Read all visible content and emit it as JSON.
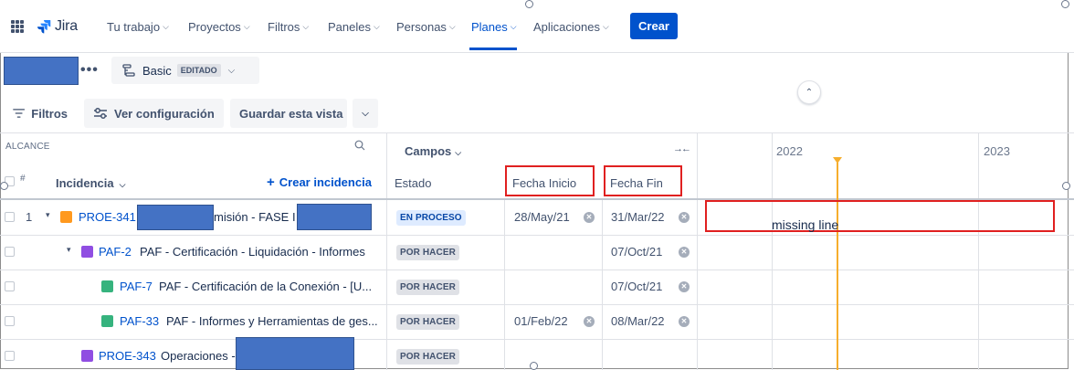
{
  "app": {
    "logo_text": "Jira",
    "icons": {
      "apps": "apps-grid-icon",
      "logo": "jira-logo-icon"
    }
  },
  "nav": {
    "items": [
      {
        "label": "Tu trabajo",
        "active": false
      },
      {
        "label": "Proyectos",
        "active": false
      },
      {
        "label": "Filtros",
        "active": false
      },
      {
        "label": "Paneles",
        "active": false
      },
      {
        "label": "Personas",
        "active": false
      },
      {
        "label": "Planes",
        "active": true
      },
      {
        "label": "Aplicaciones",
        "active": false
      }
    ],
    "create_label": "Crear",
    "accent_color": "#0052cc"
  },
  "plan": {
    "more_label": "•••",
    "view_name": "Basic",
    "view_badge": "EDITADO"
  },
  "toolbar": {
    "filters_label": "Filtros",
    "config_label": "Ver configuración",
    "save_view_label": "Guardar esta vista"
  },
  "table": {
    "scope_label": "ALCANCE",
    "hash_label": "#",
    "issue_header": "Incidencia",
    "create_issue_label": "Crear incidencia",
    "fields_label": "Campos",
    "columns": {
      "status": "Estado",
      "start_date": "Fecha Inicio",
      "end_date": "Fecha Fin"
    },
    "years": [
      "2022",
      "2023"
    ],
    "rows": [
      {
        "num": "1",
        "key": "PROE-341",
        "summary": "misión - FASE I",
        "status": "EN PROCESO",
        "start": "28/May/21",
        "end": "31/Mar/22",
        "type_color": "#ff991f"
      },
      {
        "num": "",
        "key": "PAF-2",
        "summary": "PAF - Certificación - Liquidación - Informes",
        "status": "POR HACER",
        "start": "",
        "end": "07/Oct/21",
        "type_color": "#904ee2"
      },
      {
        "num": "",
        "key": "PAF-7",
        "summary": "PAF - Certificación de la Conexión - [U...",
        "status": "POR HACER",
        "start": "",
        "end": "07/Oct/21",
        "type_color": "#36b37e"
      },
      {
        "num": "",
        "key": "PAF-33",
        "summary": "PAF - Informes y Herramientas de ges...",
        "status": "POR HACER",
        "start": "01/Feb/22",
        "end": "08/Mar/22",
        "type_color": "#36b37e"
      },
      {
        "num": "",
        "key": "PROE-343",
        "summary": "Operaciones -",
        "status": "POR HACER",
        "start": "",
        "end": "",
        "type_color": "#904ee2"
      }
    ]
  },
  "annotation": {
    "missing_label": "missing line",
    "highlight_color": "#e02020"
  },
  "timeline": {
    "today_color": "#f6ae2d"
  }
}
